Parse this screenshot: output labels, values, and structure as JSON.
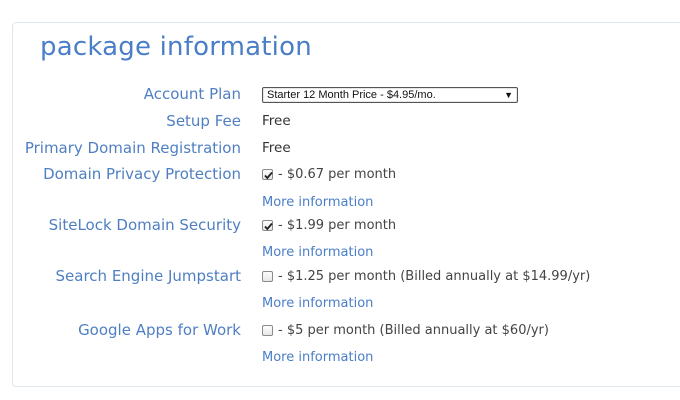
{
  "section": {
    "title": "package information"
  },
  "rows": {
    "account_plan": {
      "label": "Account Plan",
      "selected": "Starter 12 Month Price - $4.95/mo."
    },
    "setup_fee": {
      "label": "Setup Fee",
      "value": "Free"
    },
    "primary_domain": {
      "label": "Primary Domain Registration",
      "value": "Free"
    },
    "domain_privacy": {
      "label": "Domain Privacy Protection",
      "checked": true,
      "text": "- $0.67 per month",
      "more": "More information"
    },
    "sitelock": {
      "label": "SiteLock Domain Security",
      "checked": true,
      "text": "- $1.99 per month",
      "more": "More information"
    },
    "search_engine": {
      "label": "Search Engine Jumpstart",
      "checked": false,
      "text": "- $1.25 per month (Billed annually at $14.99/yr)",
      "more": "More information"
    },
    "google_apps": {
      "label": "Google Apps for Work",
      "checked": false,
      "text": "- $5 per month (Billed annually at $60/yr)",
      "more": "More information"
    }
  },
  "colors": {
    "accent": "#4a7ec8",
    "label": "#4f7fc2",
    "border": "#dfe6ee"
  }
}
